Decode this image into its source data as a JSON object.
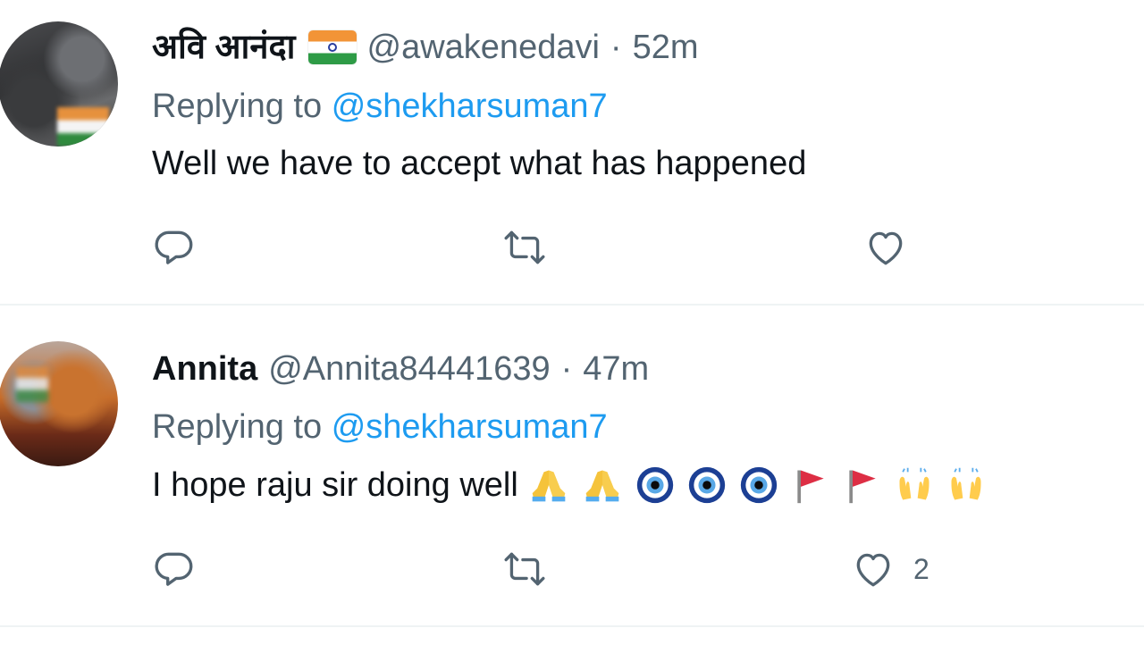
{
  "tweets": [
    {
      "display_name": "अवि आनंदा",
      "name_badge_icon": "india-flag-icon",
      "handle": "@awakenedavi",
      "separator": "·",
      "time": "52m",
      "replying_prefix": "Replying to",
      "replying_to": "@shekharsuman7",
      "text": "Well we have to accept what has happened",
      "emojis": [],
      "actions": {
        "reply_icon": "reply-icon",
        "retweet_icon": "retweet-icon",
        "like_icon": "like-icon",
        "like_count": ""
      }
    },
    {
      "display_name": "Annita",
      "handle": "@Annita84441639",
      "separator": "·",
      "time": "47m",
      "replying_prefix": "Replying to",
      "replying_to": "@shekharsuman7",
      "text": "I hope raju sir doing well",
      "emojis": [
        "🙏",
        "🙏",
        "🧿",
        "🧿",
        "🧿",
        "🚩",
        "🚩",
        "🙌",
        "🙌"
      ],
      "actions": {
        "reply_icon": "reply-icon",
        "retweet_icon": "retweet-icon",
        "like_icon": "like-icon",
        "like_count": "2"
      }
    }
  ],
  "colors": {
    "text_primary": "#0f1419",
    "text_secondary": "#536471",
    "link": "#1d9bf0",
    "divider": "#eff3f4"
  }
}
